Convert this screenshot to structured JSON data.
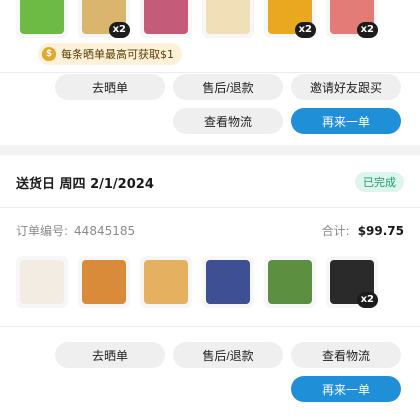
{
  "order_prev": {
    "items": [
      {
        "name": "greens",
        "color": "#6dbb45",
        "qty": ""
      },
      {
        "name": "noodles",
        "color": "#d9b56d",
        "qty": "x2"
      },
      {
        "name": "package",
        "color": "#c45b78",
        "qty": ""
      },
      {
        "name": "mayo-bottle",
        "color": "#f1dfb8",
        "qty": ""
      },
      {
        "name": "drink-box",
        "color": "#e9a820",
        "qty": "x2"
      },
      {
        "name": "wrapper-pack",
        "color": "#e37b76",
        "qty": "x2"
      }
    ],
    "cashback_tip": "每条晒单最高可获取$1",
    "cashback_icon_glyph": "$",
    "buttons": {
      "review": "去晒单",
      "refund": "售后/退款",
      "invite": "邀请好友跟买",
      "logistics": "查看物流",
      "reorder": "再来一单"
    }
  },
  "order": {
    "delivery_label": "送货日",
    "delivery_day": "周四",
    "delivery_date": "2/1/2024",
    "status": "已完成",
    "order_no_label": "订单编号:",
    "order_no": "44845185",
    "total_label": "合计:",
    "total_value": "$99.75",
    "items": [
      {
        "name": "fish-balls",
        "color": "#f3ece2",
        "qty": ""
      },
      {
        "name": "fried-snack-bag",
        "color": "#d98b3a",
        "qty": ""
      },
      {
        "name": "tofu-pack",
        "color": "#e5b060",
        "qty": ""
      },
      {
        "name": "blueberries",
        "color": "#3f4f93",
        "qty": ""
      },
      {
        "name": "mushroom-can",
        "color": "#5c8f3f",
        "qty": ""
      },
      {
        "name": "dumpling-box",
        "color": "#2a2a2a",
        "qty": "x2"
      }
    ],
    "buttons": {
      "review": "去晒单",
      "refund": "售后/退款",
      "logistics": "查看物流",
      "reorder": "再来一单"
    }
  }
}
